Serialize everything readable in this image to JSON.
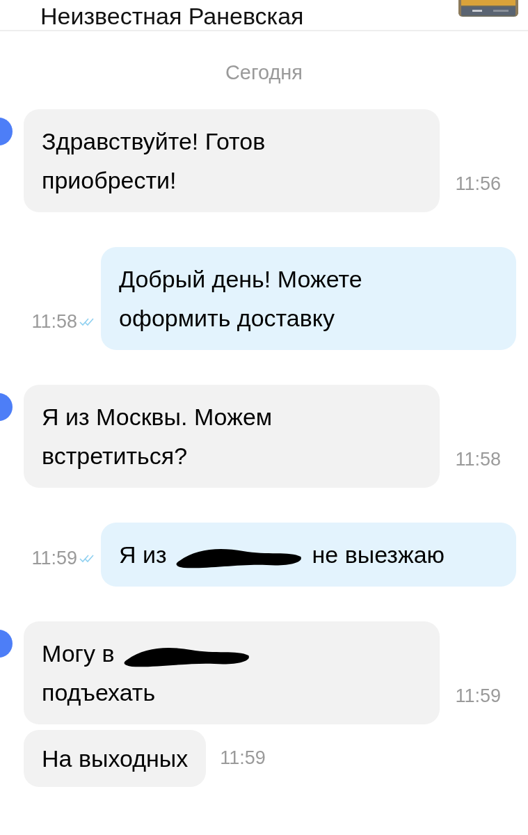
{
  "header": {
    "title": "Неизвестная Раневская"
  },
  "date_separator": "Сегодня",
  "messages": [
    {
      "kind": "incoming",
      "avatar": true,
      "parts": [
        {
          "kind": "text",
          "text": "Здравствуйте! Готов приобрести!"
        }
      ],
      "time": "11:56"
    },
    {
      "kind": "outgoing",
      "parts": [
        {
          "kind": "text",
          "text": "Добрый день! Можете оформить доставку"
        }
      ],
      "time": "11:58",
      "read": true
    },
    {
      "kind": "incoming",
      "avatar": true,
      "parts": [
        {
          "kind": "text",
          "text": "Я из Москвы. Можем встретиться?"
        }
      ],
      "time": "11:58"
    },
    {
      "kind": "outgoing",
      "parts": [
        {
          "kind": "text",
          "text": "Я из"
        },
        {
          "kind": "redacted"
        },
        {
          "kind": "text",
          "text": "не выезжаю"
        }
      ],
      "time": "11:59",
      "read": true
    },
    {
      "kind": "incoming",
      "avatar": true,
      "parts": [
        {
          "kind": "text",
          "text": "Могу в"
        },
        {
          "kind": "redacted"
        },
        {
          "kind": "text",
          "text": "подъехать"
        }
      ],
      "time": "11:59"
    },
    {
      "kind": "incoming",
      "avatar": false,
      "parts": [
        {
          "kind": "text",
          "text": "На выходных"
        }
      ],
      "time": "11:59",
      "inline_time": true
    }
  ]
}
